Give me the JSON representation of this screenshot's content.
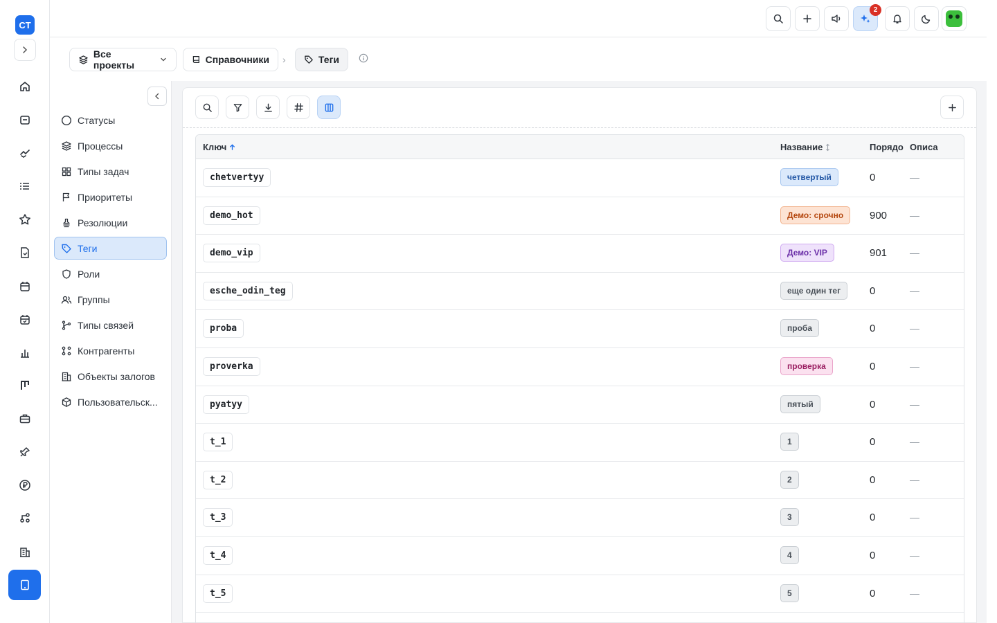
{
  "app": {
    "logo": "CT",
    "rail_icons": [
      "home-icon",
      "inbox-icon",
      "handshake-icon",
      "list-icon",
      "star-icon",
      "document-check-icon",
      "calendar-icon",
      "calendar-check-icon",
      "bar-chart-icon",
      "kanban-icon",
      "briefcase-icon",
      "pin-icon",
      "ruble-icon",
      "network-icon",
      "building-icon"
    ]
  },
  "topbar": {
    "notifications_count": "2"
  },
  "breadcrumb": {
    "projects": "Все проекты",
    "reference": "Справочники",
    "current": "Теги"
  },
  "sidebar": {
    "items": [
      {
        "label": "Статусы",
        "icon": "circle-icon"
      },
      {
        "label": "Процессы",
        "icon": "layers-icon"
      },
      {
        "label": "Типы задач",
        "icon": "grid-icon"
      },
      {
        "label": "Приоритеты",
        "icon": "flag-icon"
      },
      {
        "label": "Резолюции",
        "icon": "stamp-icon"
      },
      {
        "label": "Теги",
        "icon": "tag-icon",
        "active": true
      },
      {
        "label": "Роли",
        "icon": "shield-icon"
      },
      {
        "label": "Группы",
        "icon": "users-icon"
      },
      {
        "label": "Типы связей",
        "icon": "git-branch-icon"
      },
      {
        "label": "Контрагенты",
        "icon": "network-icon"
      },
      {
        "label": "Объекты залогов",
        "icon": "building-icon"
      },
      {
        "label": "Пользовательск...",
        "icon": "cube-icon"
      }
    ]
  },
  "table": {
    "columns": {
      "key": "Ключ",
      "name": "Название",
      "order": "Порядо",
      "description": "Описа"
    },
    "rows": [
      {
        "key": "chetvertyy",
        "name": "четвертый",
        "order": "0",
        "desc": "—",
        "color": "blue"
      },
      {
        "key": "demo_hot",
        "name": "Демо: срочно",
        "order": "900",
        "desc": "—",
        "color": "orange"
      },
      {
        "key": "demo_vip",
        "name": "Демо: VIP",
        "order": "901",
        "desc": "—",
        "color": "purple"
      },
      {
        "key": "esche_odin_teg",
        "name": "еще один тег",
        "order": "0",
        "desc": "—",
        "color": "gray"
      },
      {
        "key": "proba",
        "name": "проба",
        "order": "0",
        "desc": "—",
        "color": "gray"
      },
      {
        "key": "proverka",
        "name": "проверка",
        "order": "0",
        "desc": "—",
        "color": "pink"
      },
      {
        "key": "pyatyy",
        "name": "пятый",
        "order": "0",
        "desc": "—",
        "color": "gray"
      },
      {
        "key": "t_1",
        "name": "1",
        "order": "0",
        "desc": "—",
        "color": "gray"
      },
      {
        "key": "t_2",
        "name": "2",
        "order": "0",
        "desc": "—",
        "color": "gray"
      },
      {
        "key": "t_3",
        "name": "3",
        "order": "0",
        "desc": "—",
        "color": "gray"
      },
      {
        "key": "t_4",
        "name": "4",
        "order": "0",
        "desc": "—",
        "color": "gray"
      },
      {
        "key": "t_5",
        "name": "5",
        "order": "0",
        "desc": "—",
        "color": "gray"
      }
    ]
  },
  "tag_colors": {
    "blue": {
      "bg": "#dbe9fb",
      "border": "#a9c8f0",
      "text": "#2458a6"
    },
    "orange": {
      "bg": "#fde3d3",
      "border": "#f2b48f",
      "text": "#b4470f"
    },
    "purple": {
      "bg": "#efe2fb",
      "border": "#cfa9f0",
      "text": "#6b2fa8"
    },
    "gray": {
      "bg": "#eceef0",
      "border": "#c9ced3",
      "text": "#4a5159"
    },
    "pink": {
      "bg": "#fbe1ef",
      "border": "#eaa6cb",
      "text": "#9b1f62"
    }
  }
}
